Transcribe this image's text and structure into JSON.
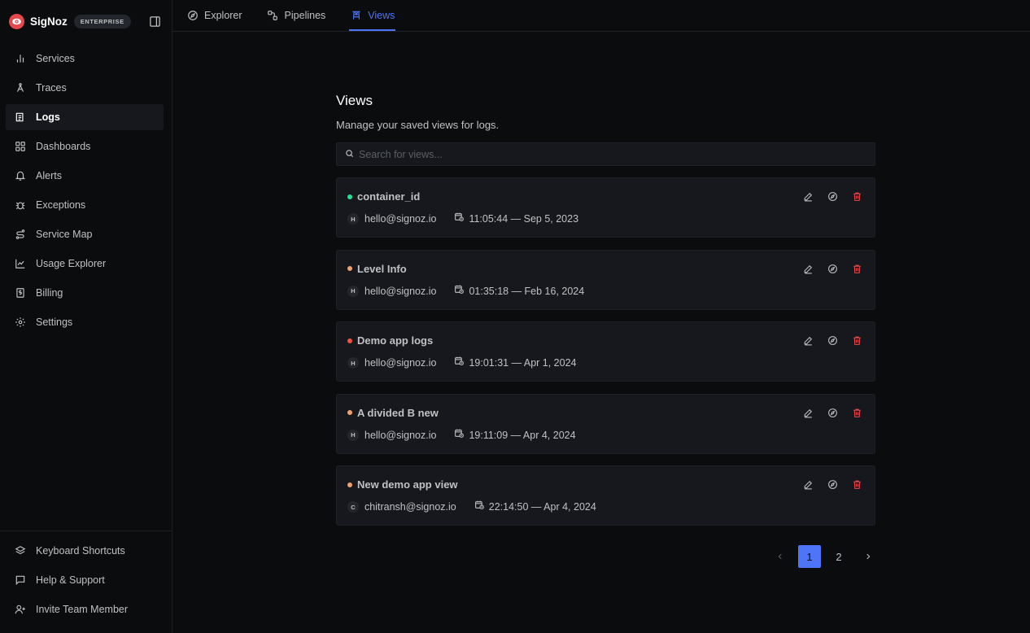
{
  "brand": {
    "name": "SigNoz",
    "badge": "ENTERPRISE",
    "logo_icon": "signoz-eye-logo",
    "accent": "#e5484d"
  },
  "sidebar": {
    "items": [
      {
        "label": "Services",
        "icon": "bar-chart-icon",
        "active": false
      },
      {
        "label": "Traces",
        "icon": "traces-icon",
        "active": false
      },
      {
        "label": "Logs",
        "icon": "logs-icon",
        "active": true
      },
      {
        "label": "Dashboards",
        "icon": "dashboard-grid-icon",
        "active": false
      },
      {
        "label": "Alerts",
        "icon": "bell-icon",
        "active": false
      },
      {
        "label": "Exceptions",
        "icon": "bug-icon",
        "active": false
      },
      {
        "label": "Service Map",
        "icon": "route-icon",
        "active": false
      },
      {
        "label": "Usage Explorer",
        "icon": "line-chart-icon",
        "active": false
      },
      {
        "label": "Billing",
        "icon": "receipt-icon",
        "active": false
      },
      {
        "label": "Settings",
        "icon": "gear-icon",
        "active": false
      }
    ],
    "footer": [
      {
        "label": "Keyboard Shortcuts",
        "icon": "layers-icon"
      },
      {
        "label": "Help & Support",
        "icon": "message-icon"
      },
      {
        "label": "Invite Team Member",
        "icon": "user-plus-icon"
      }
    ]
  },
  "tabs": [
    {
      "label": "Explorer",
      "icon": "compass-icon",
      "active": false
    },
    {
      "label": "Pipelines",
      "icon": "workflow-icon",
      "active": false
    },
    {
      "label": "Views",
      "icon": "tower-icon",
      "active": true
    }
  ],
  "page": {
    "title": "Views",
    "subtitle": "Manage your saved views for logs.",
    "search_placeholder": "Search for views..."
  },
  "views": [
    {
      "name": "container_id",
      "dot_color": "#25e192",
      "avatar": "H",
      "author": "hello@signoz.io",
      "time": "11:05:44 — Sep 5, 2023"
    },
    {
      "name": "Level Info",
      "dot_color": "#f3a06b",
      "avatar": "H",
      "author": "hello@signoz.io",
      "time": "01:35:18 — Feb 16, 2024"
    },
    {
      "name": "Demo app logs",
      "dot_color": "#f3503e",
      "avatar": "H",
      "author": "hello@signoz.io",
      "time": "19:01:31 — Apr 1, 2024"
    },
    {
      "name": "A divided B new",
      "dot_color": "#f3a06b",
      "avatar": "H",
      "author": "hello@signoz.io",
      "time": "19:11:09 — Apr 4, 2024"
    },
    {
      "name": "New demo app view",
      "dot_color": "#f3a06b",
      "avatar": "C",
      "author": "chitransh@signoz.io",
      "time": "22:14:50 — Apr 4, 2024"
    }
  ],
  "pagination": {
    "pages": [
      "1",
      "2"
    ],
    "current": "1"
  },
  "colors": {
    "accent": "#4e74f8",
    "danger": "#e5484d",
    "background": "#0b0c0e",
    "card": "#16181d"
  }
}
